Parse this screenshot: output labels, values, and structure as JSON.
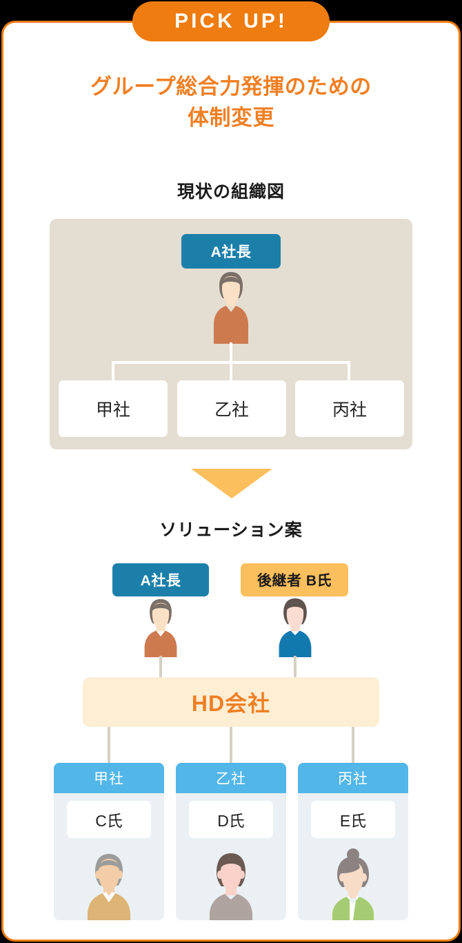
{
  "badge": {
    "label": "PICK UP!"
  },
  "title": {
    "line1": "グループ総合力発揮のための",
    "line2": "体制変更"
  },
  "sections": {
    "current": {
      "heading": "現状の組織図",
      "top": {
        "label": "A社長",
        "avatar": "male-president-avatar"
      },
      "children": [
        "甲社",
        "乙社",
        "丙社"
      ]
    },
    "arrow": {
      "icon": "down-triangle-arrow"
    },
    "solution": {
      "heading": "ソリューション案",
      "people": [
        {
          "label": "A社長",
          "avatar": "male-president-avatar",
          "badge_color": "#1C7FAA"
        },
        {
          "label": "後継者 B氏",
          "avatar": "male-successor-avatar",
          "badge_color": "#FBBF5E"
        }
      ],
      "holding": {
        "label": "HD会社"
      },
      "subsidiaries": [
        {
          "company": "甲社",
          "person": "C氏",
          "avatar": "senior-male-avatar"
        },
        {
          "company": "乙社",
          "person": "D氏",
          "avatar": "middle-male-avatar"
        },
        {
          "company": "丙社",
          "person": "E氏",
          "avatar": "female-avatar"
        }
      ]
    }
  },
  "colors": {
    "accent_orange": "#EE7C10",
    "title_orange": "#F07F23",
    "badge_blue": "#1C7FAA",
    "badge_amber": "#FBBF5E",
    "panel_beige": "#E4DDD1",
    "card_blue": "#52B6E8",
    "card_body": "#EAF0F3",
    "hd_cream": "#FDEED4",
    "connector_gray": "#D6D0C4"
  }
}
